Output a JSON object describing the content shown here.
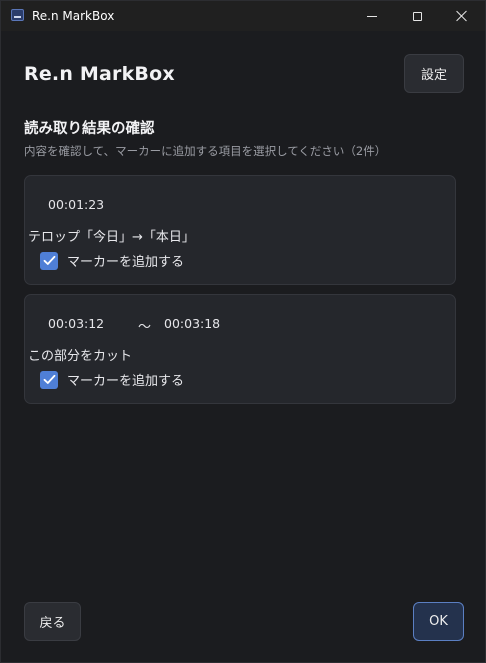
{
  "window": {
    "title": "Re.n MarkBox"
  },
  "header": {
    "app_name": "Re.n MarkBox",
    "settings_label": "設定"
  },
  "section": {
    "title": "読み取り結果の確認",
    "subtitle": "内容を確認して、マーカーに追加する項目を選択してください（2件）"
  },
  "items": [
    {
      "start": "00:01:23",
      "text": "テロップ「今日」→「本日」",
      "checkbox_label": "マーカーを追加する",
      "checked": true
    },
    {
      "start": "00:03:12",
      "separator": "〜",
      "end": "00:03:18",
      "text": "この部分をカット",
      "checkbox_label": "マーカーを追加する",
      "checked": true
    }
  ],
  "footer": {
    "back_label": "戻る",
    "ok_label": "OK"
  },
  "colors": {
    "accent": "#4f7fd6",
    "background": "#1b1c1f",
    "card": "#25272c"
  }
}
